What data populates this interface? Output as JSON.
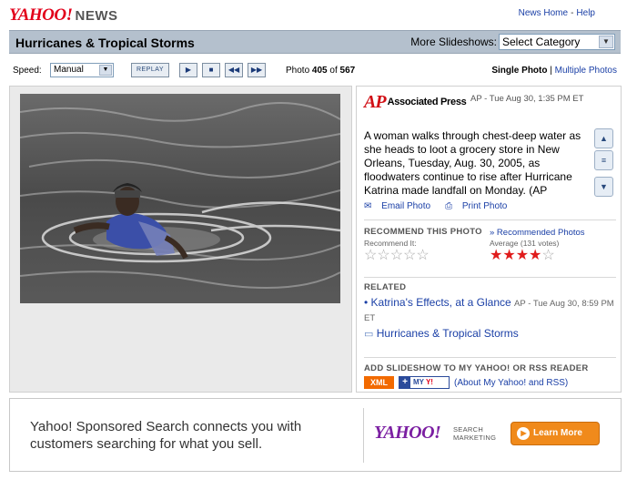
{
  "header": {
    "logo": "YAHOO!",
    "logo_section": "NEWS",
    "links": [
      "News Home",
      "Help"
    ]
  },
  "titlebar": {
    "title": "Hurricanes & Tropical Storms",
    "more_label": "More Slideshows:",
    "select_value": "Select Category"
  },
  "controls": {
    "speed_label": "Speed:",
    "speed_value": "Manual",
    "replay_label": "REPLAY",
    "photo_prefix": "Photo",
    "photo_current": "405",
    "photo_of": "of",
    "photo_total": "567",
    "single_photo": "Single Photo",
    "multiple_photos": "Multiple Photos"
  },
  "story": {
    "source_logo": "AP",
    "source_name": "Associated Press",
    "date": "AP - Tue Aug 30, 1:35 PM ET",
    "caption": "A woman walks through chest-deep water as she heads to loot a grocery store in New Orleans, Tuesday, Aug. 30, 2005, as floodwaters continue to rise after Hurricane Katrina made landfall on Monday. (AP",
    "email_label": "Email Photo",
    "print_label": "Print Photo"
  },
  "rating": {
    "heading": "RECOMMEND THIS PHOTO",
    "recommended_link": "» Recommended Photos",
    "recommend_it": "Recommend It:",
    "average_label": "Average (131 votes)",
    "average_stars": 4,
    "max_stars": 5
  },
  "related": {
    "heading": "RELATED",
    "item1_title": "Katrina's Effects, at a Glance",
    "item1_source": "AP - Tue Aug 30, 8:59 PM ET",
    "item2_title": "Hurricanes & Tropical Storms"
  },
  "rss": {
    "heading": "ADD SLIDESHOW TO MY YAHOO! OR RSS READER",
    "xml_label": "XML",
    "myyahoo_label": "MY",
    "myyahoo_y": "Y!",
    "about_link": "(About My Yahoo! and RSS)"
  },
  "ad": {
    "text": "Yahoo! Sponsored Search connects you with customers searching for what you sell.",
    "logo": "YAHOO!",
    "logo_sub1": "SEARCH",
    "logo_sub2": "MARKETING",
    "learn_more": "Learn More"
  },
  "colors": {
    "yahoo_red": "#e2001a",
    "titlebar_bg": "#b4c0cd",
    "link_blue": "#1a3fa6",
    "star_red": "#e01b1b",
    "cta_orange": "#f08a1b"
  }
}
